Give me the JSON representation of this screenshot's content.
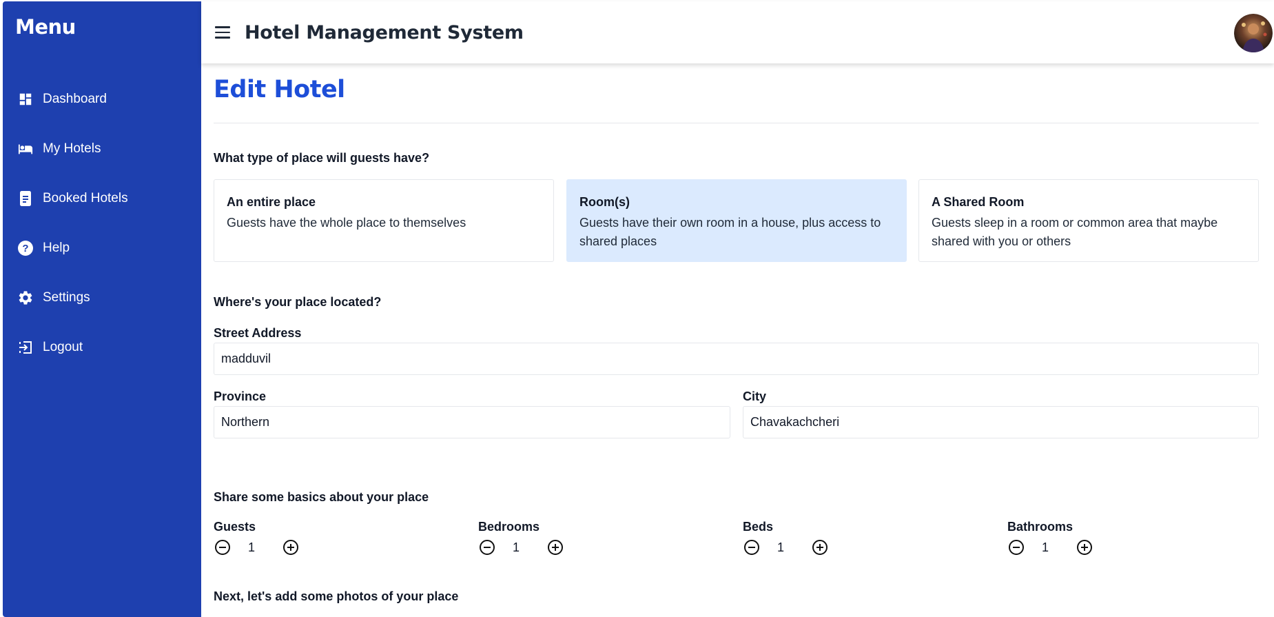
{
  "sidebar": {
    "title": "Menu",
    "items": [
      {
        "label": "Dashboard",
        "icon": "dashboard-icon"
      },
      {
        "label": "My Hotels",
        "icon": "bed-icon"
      },
      {
        "label": "Booked Hotels",
        "icon": "booking-icon"
      },
      {
        "label": "Help",
        "icon": "help-icon"
      },
      {
        "label": "Settings",
        "icon": "gear-icon"
      },
      {
        "label": "Logout",
        "icon": "logout-icon"
      }
    ]
  },
  "header": {
    "title": "Hotel Management System",
    "menu_icon": "hamburger-icon",
    "avatar": "user-avatar"
  },
  "page": {
    "title": "Edit Hotel"
  },
  "place_type": {
    "heading": "What type of place will guests have?",
    "selected": 1,
    "options": [
      {
        "title": "An entire place",
        "desc": "Guests have the whole place to themselves"
      },
      {
        "title": "Room(s)",
        "desc": "Guests have their own room in a house, plus access to shared places"
      },
      {
        "title": "A Shared Room",
        "desc": "Guests sleep in a room or common area that maybe shared with you or others"
      }
    ]
  },
  "location": {
    "heading": "Where's your place located?",
    "street_label": "Street Address",
    "street_value": "madduvil",
    "province_label": "Province",
    "province_value": "Northern",
    "city_label": "City",
    "city_value": "Chavakachcheri"
  },
  "basics": {
    "heading": "Share some basics about your place",
    "counters": [
      {
        "label": "Guests",
        "value": "1"
      },
      {
        "label": "Bedrooms",
        "value": "1"
      },
      {
        "label": "Beds",
        "value": "1"
      },
      {
        "label": "Bathrooms",
        "value": "1"
      }
    ]
  },
  "photos": {
    "heading": "Next, let's add some photos of your place"
  },
  "colors": {
    "sidebar_bg": "#1e40af",
    "accent": "#1d4ed8",
    "selected_card": "#dbeafe"
  }
}
